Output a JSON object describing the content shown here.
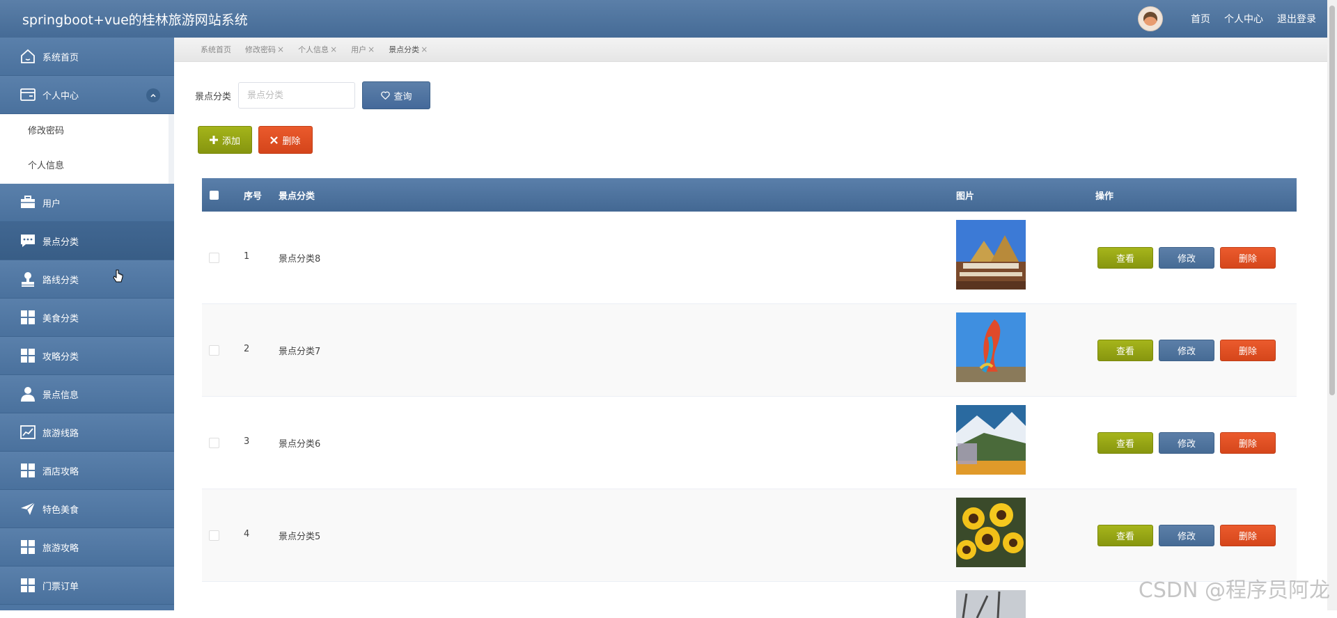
{
  "header": {
    "title": "springboot+vue的桂林旅游网站系统",
    "links": [
      "首页",
      "个人中心",
      "退出登录"
    ]
  },
  "sidebar": {
    "items": [
      {
        "label": "系统首页",
        "icon": "home-icon"
      },
      {
        "label": "个人中心",
        "icon": "wallet-icon",
        "expanded": true,
        "sub": [
          "修改密码",
          "个人信息"
        ]
      },
      {
        "label": "用户",
        "icon": "briefcase-icon"
      },
      {
        "label": "景点分类",
        "icon": "chat-icon",
        "active": true
      },
      {
        "label": "路线分类",
        "icon": "stamp-icon"
      },
      {
        "label": "美食分类",
        "icon": "grid-icon"
      },
      {
        "label": "攻略分类",
        "icon": "grid-icon"
      },
      {
        "label": "景点信息",
        "icon": "person-icon"
      },
      {
        "label": "旅游线路",
        "icon": "chart-icon"
      },
      {
        "label": "酒店攻略",
        "icon": "grid-icon"
      },
      {
        "label": "特色美食",
        "icon": "paper-plane-icon"
      },
      {
        "label": "旅游攻略",
        "icon": "grid-icon"
      },
      {
        "label": "门票订单",
        "icon": "grid-icon"
      }
    ]
  },
  "tabs": [
    "系统首页",
    "修改密码",
    "个人信息",
    "用户",
    "景点分类"
  ],
  "search": {
    "label": "景点分类",
    "placeholder": "景点分类",
    "button": "查询"
  },
  "actions": {
    "add": "添加",
    "delete": "删除"
  },
  "table": {
    "headers": {
      "index": "序号",
      "category": "景点分类",
      "image": "图片",
      "ops": "操作"
    },
    "rows": [
      {
        "index": "1",
        "category": "景点分类8",
        "image": "temple"
      },
      {
        "index": "2",
        "category": "景点分类7",
        "image": "sculpture"
      },
      {
        "index": "3",
        "category": "景点分类6",
        "image": "mountain"
      },
      {
        "index": "4",
        "category": "景点分类5",
        "image": "sunflowers"
      }
    ],
    "row_buttons": {
      "view": "查看",
      "edit": "修改",
      "remove": "删除"
    }
  },
  "watermark": "CSDN @程序员阿龙",
  "colors": {
    "primary": "#4e76a3",
    "success": "#94a414",
    "danger": "#df4f22"
  }
}
